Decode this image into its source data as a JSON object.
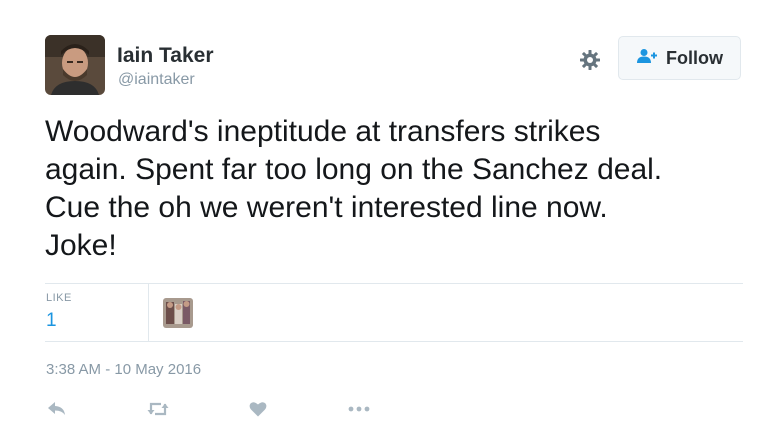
{
  "user": {
    "name": "Iain Taker",
    "handle": "@iaintaker"
  },
  "header": {
    "follow_label": "Follow"
  },
  "tweet": {
    "text": "Woodward's ineptitude at transfers strikes\nagain. Spent far too long on the Sanchez deal.\nCue the oh we weren't interested line now.\nJoke!"
  },
  "stats": {
    "likes_label": "LIKE",
    "likes_count": "1"
  },
  "meta": {
    "timestamp": "3:38 AM - 10 May 2016"
  },
  "actions": {
    "icons": [
      "reply-icon",
      "retweet-icon",
      "like-icon",
      "more-icon"
    ]
  },
  "colors": {
    "accent": "#1b95e0",
    "muted": "#8899a6",
    "text": "#14171a",
    "border": "#e1e8ed"
  }
}
